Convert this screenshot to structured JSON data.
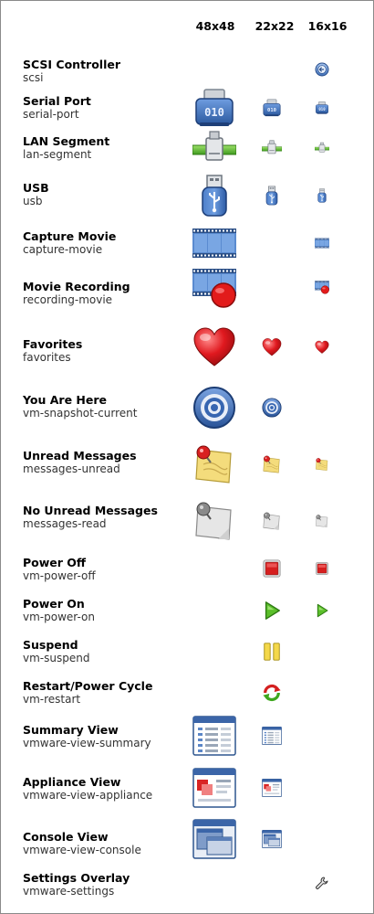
{
  "columns": [
    "48x48",
    "22x22",
    "16x16"
  ],
  "rows": [
    {
      "name": "SCSI Controller",
      "id": "scsi",
      "icon": "scsi-icon",
      "sizes": [
        "16x16"
      ]
    },
    {
      "name": "Serial Port",
      "id": "serial-port",
      "icon": "serial-port-icon",
      "sizes": [
        "48x48",
        "22x22",
        "16x16"
      ],
      "badge": "010"
    },
    {
      "name": "LAN Segment",
      "id": "lan-segment",
      "icon": "lan-segment-icon",
      "sizes": [
        "48x48",
        "22x22",
        "16x16"
      ]
    },
    {
      "name": "USB",
      "id": "usb",
      "icon": "usb-icon",
      "sizes": [
        "48x48",
        "22x22",
        "16x16"
      ]
    },
    {
      "name": "Capture Movie",
      "id": "capture-movie",
      "icon": "film-icon",
      "sizes": [
        "48x48",
        "16x16"
      ]
    },
    {
      "name": "Movie Recording",
      "id": "recording-movie",
      "icon": "film-record-icon",
      "sizes": [
        "48x48",
        "16x16"
      ]
    },
    {
      "name": "Favorites",
      "id": "favorites",
      "icon": "heart-icon",
      "sizes": [
        "48x48",
        "22x22",
        "16x16"
      ]
    },
    {
      "name": "You Are Here",
      "id": "vm-snapshot-current",
      "icon": "target-icon",
      "sizes": [
        "48x48",
        "22x22"
      ]
    },
    {
      "name": "Unread Messages",
      "id": "messages-unread",
      "icon": "note-pin-unread-icon",
      "sizes": [
        "48x48",
        "22x22",
        "16x16"
      ]
    },
    {
      "name": "No Unread Messages",
      "id": "messages-read",
      "icon": "note-pin-read-icon",
      "sizes": [
        "48x48",
        "22x22",
        "16x16"
      ]
    },
    {
      "name": "Power Off",
      "id": "vm-power-off",
      "icon": "stop-icon",
      "sizes": [
        "22x22",
        "16x16"
      ]
    },
    {
      "name": "Power On",
      "id": "vm-power-on",
      "icon": "play-icon",
      "sizes": [
        "22x22",
        "16x16"
      ]
    },
    {
      "name": "Suspend",
      "id": "vm-suspend",
      "icon": "pause-icon",
      "sizes": [
        "22x22"
      ]
    },
    {
      "name": "Restart/Power Cycle",
      "id": "vm-restart",
      "icon": "restart-icon",
      "sizes": [
        "22x22"
      ]
    },
    {
      "name": "Summary View",
      "id": "vmware-view-summary",
      "icon": "summary-view-icon",
      "sizes": [
        "48x48",
        "22x22"
      ]
    },
    {
      "name": "Appliance View",
      "id": "vmware-view-appliance",
      "icon": "appliance-view-icon",
      "sizes": [
        "48x48",
        "22x22"
      ]
    },
    {
      "name": "Console View",
      "id": "vmware-view-console",
      "icon": "console-view-icon",
      "sizes": [
        "48x48",
        "22x22"
      ]
    },
    {
      "name": "Settings Overlay",
      "id": "vmware-settings",
      "icon": "wrench-icon",
      "sizes": [
        "16x16"
      ]
    }
  ]
}
